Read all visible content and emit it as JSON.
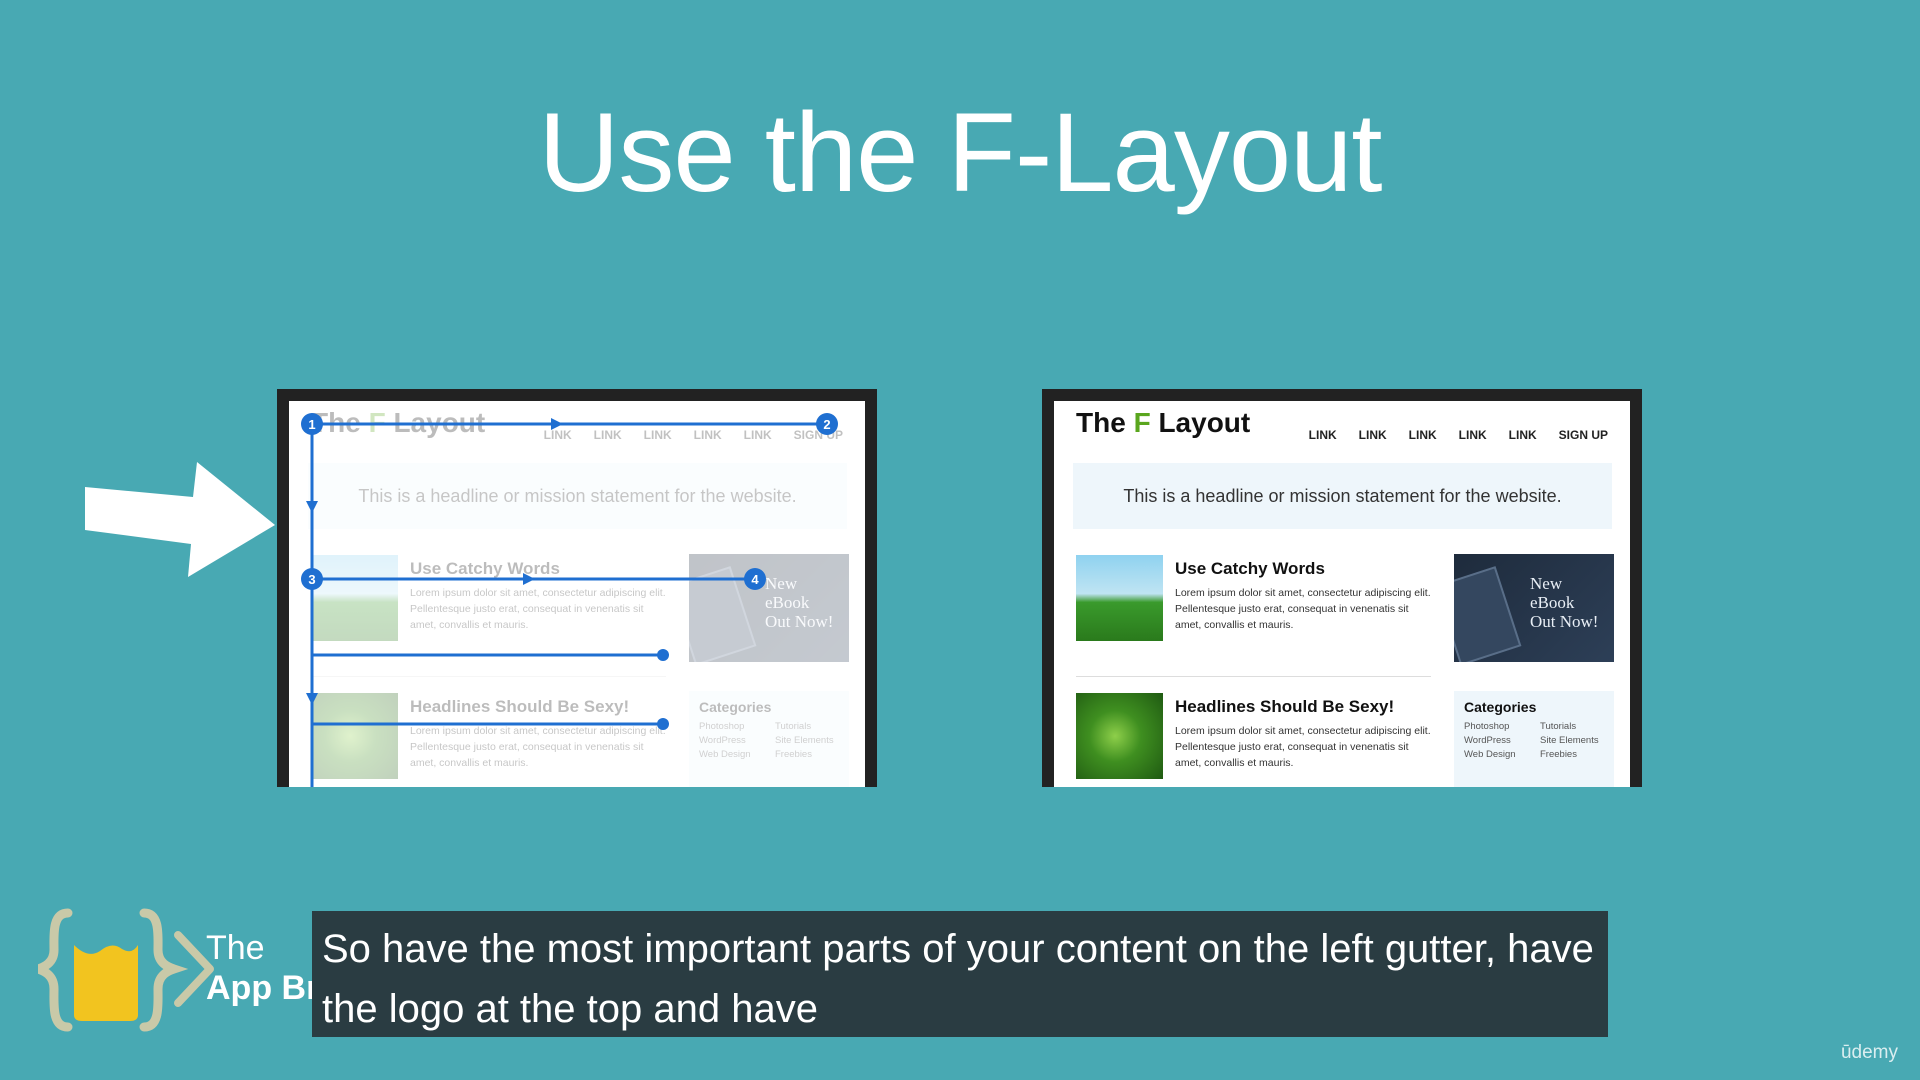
{
  "slide": {
    "title": "Use the F-Layout"
  },
  "mockup": {
    "logo_prefix": "The ",
    "logo_f": "F",
    "logo_suffix": " Layout",
    "nav": [
      "LINK",
      "LINK",
      "LINK",
      "LINK",
      "LINK",
      "SIGN UP"
    ],
    "mission": "This is a headline or mission statement for the website.",
    "posts": [
      {
        "title": "Use Catchy Words",
        "body": "Lorem ipsum dolor sit amet, consectetur adipiscing elit. Pellentesque justo erat, consequat in venenatis sit amet, convallis et mauris."
      },
      {
        "title": "Headlines Should Be Sexy!",
        "body": "Lorem ipsum dolor sit amet, consectetur adipiscing elit. Pellentesque justo erat, consequat in venenatis sit amet, convallis et mauris."
      }
    ],
    "ebook": "New\neBook\nOut Now!",
    "categories": {
      "title": "Categories",
      "items": [
        "Photoshop",
        "Tutorials",
        "WordPress",
        "Site Elements",
        "Web Design",
        "Freebies"
      ]
    },
    "eye_path_markers": [
      "1",
      "2",
      "3",
      "4"
    ]
  },
  "caption": {
    "text": "So have the most important parts of your content on the left gutter, have the logo at the top and have"
  },
  "branding": {
    "line1": "The",
    "line2": "App Brewery",
    "watermark": "ūdemy"
  },
  "colors": {
    "background": "#48a9b3",
    "accent_green": "#5aa61e",
    "eye_path_blue": "#1f6fd1",
    "caption_bg": "#2a3c42"
  }
}
